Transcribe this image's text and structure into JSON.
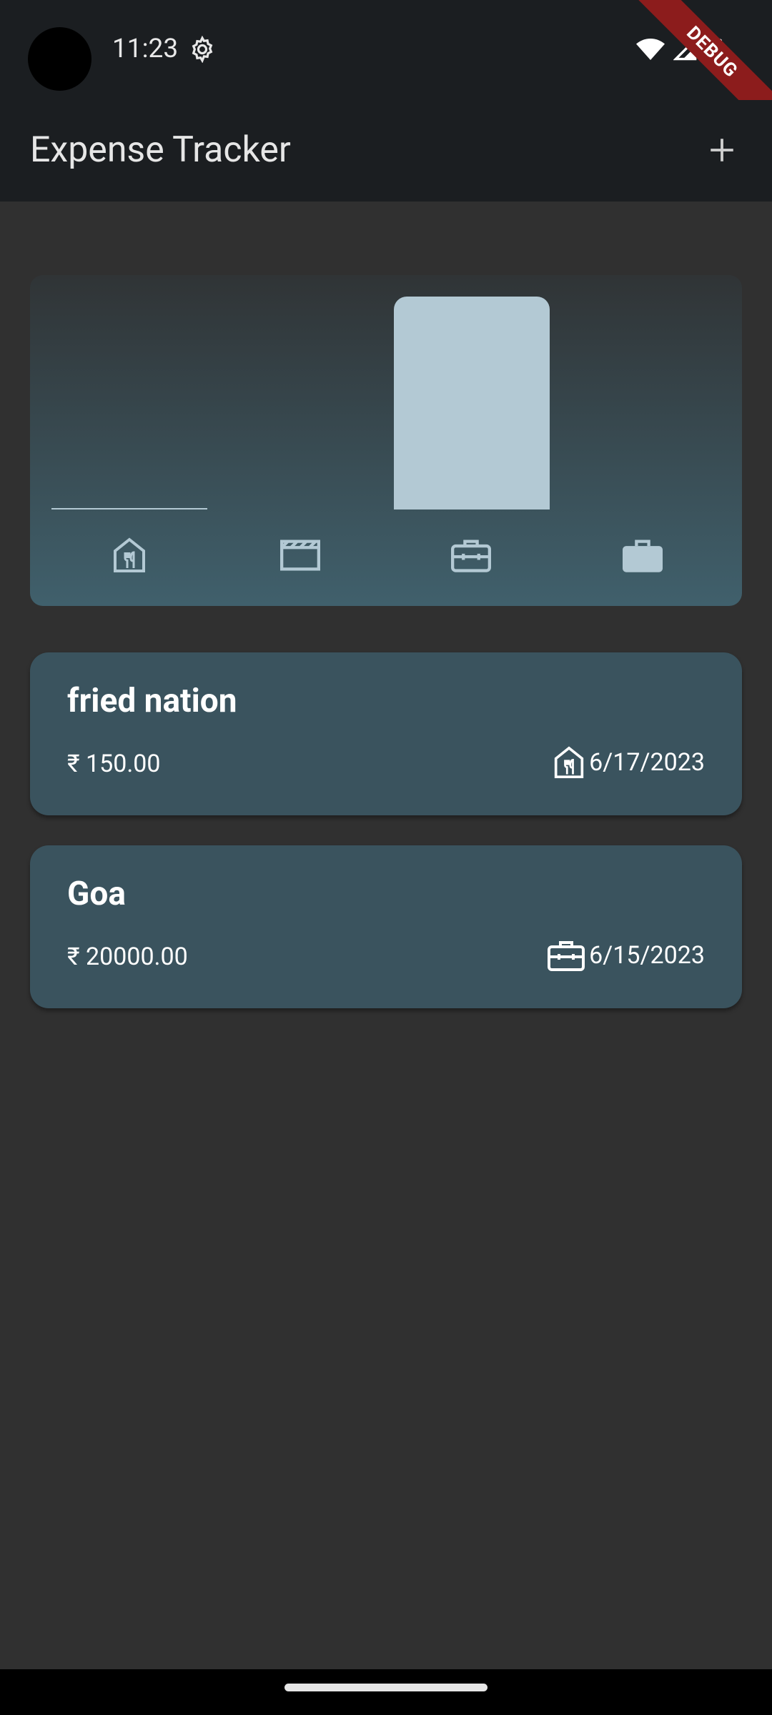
{
  "status_bar": {
    "time": "11:23",
    "icons": [
      "settings-icon",
      "wifi-icon",
      "signal-icon",
      "battery-icon"
    ]
  },
  "debug_banner": "DEBUG",
  "app_bar": {
    "title": "Expense Tracker",
    "add_icon": "add-icon"
  },
  "chart_data": {
    "type": "bar",
    "categories": [
      "food",
      "leisure",
      "travel",
      "work"
    ],
    "category_icons": [
      "restaurant-icon",
      "movie-icon",
      "luggage-icon",
      "work-icon"
    ],
    "values": [
      150,
      0,
      20000,
      0
    ],
    "ylim": [
      0,
      20000
    ],
    "bar_color": "#b3c9d4"
  },
  "expenses": [
    {
      "title": "fried nation",
      "amount": "₹ 150.00",
      "category_icon": "restaurant-icon",
      "date": "6/17/2023"
    },
    {
      "title": "Goa",
      "amount": "₹ 20000.00",
      "category_icon": "luggage-icon",
      "date": "6/15/2023"
    }
  ],
  "colors": {
    "background": "#303030",
    "app_bar": "#1b1e21",
    "card": "#3a535e",
    "bar": "#b3c9d4"
  }
}
